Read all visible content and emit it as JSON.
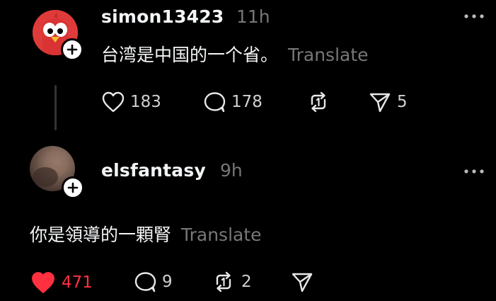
{
  "posts": [
    {
      "username": "simon13423",
      "time": "11h",
      "text": "台湾是中国的一个省。",
      "translate_label": "Translate",
      "likes": "183",
      "replies": "178",
      "reposts": "",
      "shares": "5",
      "liked": false,
      "avatar_icon": "red-bird-avatar"
    },
    {
      "username": "elsfantasy",
      "time": "9h",
      "text": "你是領導的一顆腎",
      "translate_label": "Translate",
      "likes": "471",
      "replies": "9",
      "reposts": "2",
      "shares": "",
      "liked": true,
      "avatar_icon": "photo-avatar"
    }
  ],
  "colors": {
    "background": "#000000",
    "primary_text": "#f3f5f7",
    "secondary_text": "#777777",
    "like_red": "#ff3040"
  }
}
